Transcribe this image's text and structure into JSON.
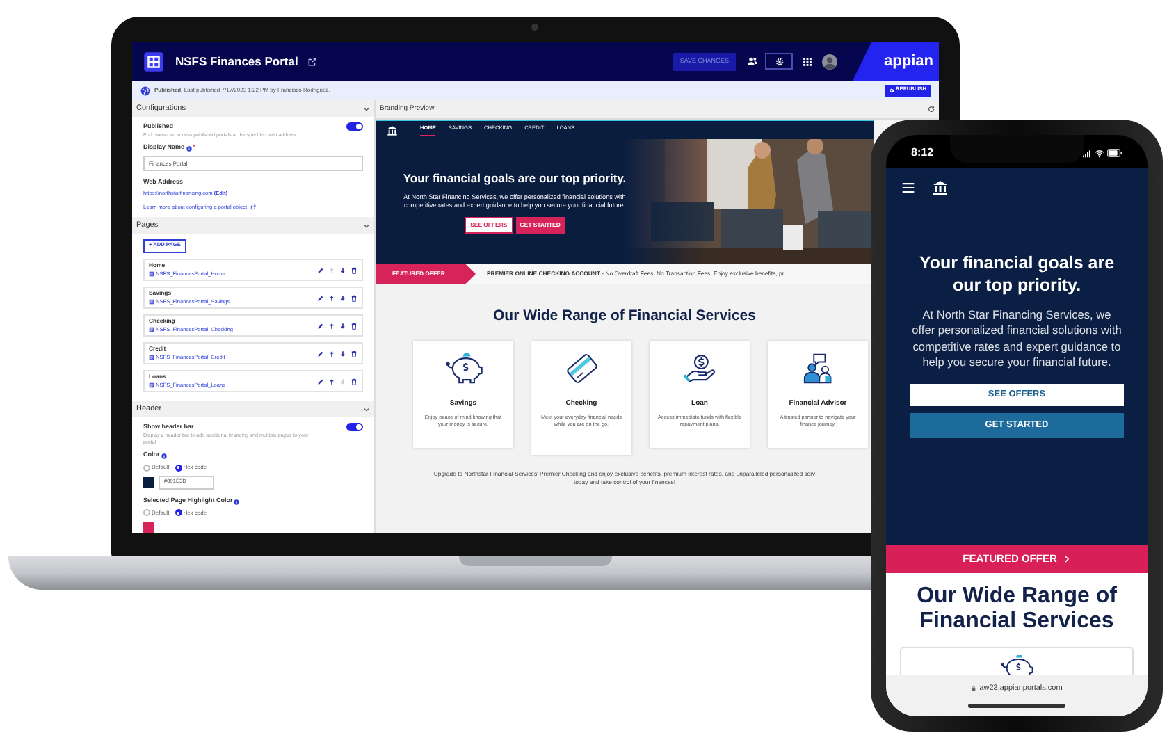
{
  "laptop": {
    "app_header": {
      "title": "NSFS Finances Portal",
      "save_button": "SAVE CHANGES",
      "brand": "appian"
    },
    "publish_bar": {
      "status": "**Published.** Last published 7/17/2023 1:22 PM by Francisco Rodriguez.",
      "republish_button": "REPUBLISH"
    },
    "configurations": {
      "title": "Configurations",
      "published": {
        "label": "Published",
        "description": "End users can access published portals at the specified web address.",
        "on": true
      },
      "display_name": {
        "label": "Display Name",
        "required_mark": "*",
        "value": "Finances Portal"
      },
      "web_address": {
        "label": "Web Address",
        "url": "https://northstarfinancing.com",
        "edit_link": "(Edit)"
      },
      "learn_more": "Learn more about configuring a portal object"
    },
    "pages": {
      "title": "Pages",
      "add_button": "+ ADD PAGE",
      "items": [
        {
          "name": "Home",
          "object": "NSFS_FinancesPortal_Home",
          "up_disabled": true,
          "down_disabled": false
        },
        {
          "name": "Savings",
          "object": "NSFS_FinancesPortal_Savings",
          "up_disabled": false,
          "down_disabled": false
        },
        {
          "name": "Checking",
          "object": "NSFS_FinancesPortal_Checking",
          "up_disabled": false,
          "down_disabled": false
        },
        {
          "name": "Credit",
          "object": "NSFS_FinancesPortal_Credit",
          "up_disabled": false,
          "down_disabled": false
        },
        {
          "name": "Loans",
          "object": "NSFS_FinancesPortal_Loans",
          "up_disabled": false,
          "down_disabled": true
        }
      ]
    },
    "header": {
      "title": "Header",
      "show_header_bar": {
        "label": "Show header bar",
        "description": "Display a header bar to add additional branding and multiple pages to your portal",
        "on": true
      },
      "color": {
        "label": "Color",
        "options": [
          {
            "label": "Default",
            "selected": false
          },
          {
            "label": "Hex code",
            "selected": true
          }
        ],
        "hex": "#091E3D"
      },
      "highlight_color": {
        "label": "Selected Page Highlight Color",
        "options": [
          {
            "label": "Default",
            "selected": false
          },
          {
            "label": "Hex code",
            "selected": true
          }
        ]
      }
    },
    "preview": {
      "title": "Branding Preview",
      "nav": [
        {
          "label": "HOME",
          "selected": true
        },
        {
          "label": "SAVINGS",
          "selected": false
        },
        {
          "label": "CHECKING",
          "selected": false
        },
        {
          "label": "CREDIT",
          "selected": false
        },
        {
          "label": "LOANS",
          "selected": false
        }
      ],
      "hero": {
        "heading": "Your financial goals are our top priority.",
        "text": "At North Star Financing Services, we offer personalized financial solutions with competitive rates and expert guidance to help you secure your financial future.",
        "buttons": [
          "SEE OFFERS",
          "GET STARTED"
        ]
      },
      "featured": {
        "tag": "FEATURED OFFER",
        "text": "**PREMIER ONLINE CHECKING ACCOUNT** - No Overdraft Fees. No Transaction Fees. Enjoy exclusive benefits, pr"
      },
      "services_title": "Our Wide Range of Financial Services",
      "services": [
        {
          "kind": "savings",
          "title": "Savings",
          "text": "Enjoy peace of mind knowing that your money is secure."
        },
        {
          "kind": "checking",
          "title": "Checking",
          "text": "Meet your everyday financial needs while you are on the go."
        },
        {
          "kind": "loan",
          "title": "Loan",
          "text": "Access immediate funds with flexible repayment plans."
        },
        {
          "kind": "advisor",
          "title": "Financial Advisor",
          "text": "A trusted partner to navigate your finance journey."
        }
      ],
      "footer_text": "Upgrade to Northstar Financial Services' Premier Checking and enjoy exclusive benefits, premium interest rates, and unparalleled personalized serv\ntoday and take control of your finances!"
    }
  },
  "phone": {
    "time": "8:12",
    "hero": {
      "heading": "Your financial goals are our top priority.",
      "text": "At North Star Financing Services, we offer personalized financial solutions with competitive rates and expert guidance to help you secure your financial future.",
      "buttons": [
        "SEE OFFERS",
        "GET STARTED"
      ]
    },
    "featured_button": "FEATURED OFFER",
    "services_title": "Our Wide Range of Financial Services",
    "url": "aw23.appianportals.com"
  }
}
